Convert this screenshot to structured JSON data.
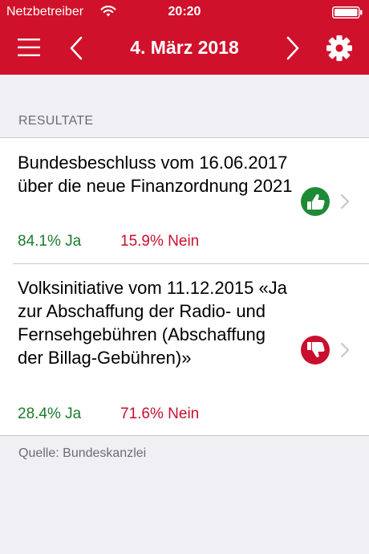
{
  "status_bar": {
    "carrier": "Netzbetreiber",
    "time": "20:20",
    "wifi_icon": "wifi-icon",
    "battery_icon": "battery-icon"
  },
  "navbar": {
    "title": "4. März 2018",
    "menu_icon": "hamburger-menu-icon",
    "prev_icon": "chevron-left-icon",
    "next_icon": "chevron-right-icon",
    "settings_icon": "gear-icon"
  },
  "colors": {
    "brand_red": "#d0112b",
    "yes_green": "#1d7a2c",
    "no_red": "#c8102e",
    "background": "#efeff4"
  },
  "results": {
    "header": "RESULTATE",
    "items": [
      {
        "title": "Bundesbeschluss vom 16.06.2017 über die neue Finanzordnung 2021",
        "yes": "84.1% Ja",
        "no": "15.9% Nein",
        "outcome_icon": "thumbs-up-icon"
      },
      {
        "title": "Volksinitiative vom 11.12.2015 «Ja zur Abschaffung der Radio- und Fernsehgebühren (Abschaffung der Billag-Gebühren)»",
        "yes": "28.4% Ja",
        "no": "71.6% Nein",
        "outcome_icon": "thumbs-down-icon"
      }
    ]
  },
  "footer": {
    "source": "Quelle: Bundeskanzlei"
  }
}
